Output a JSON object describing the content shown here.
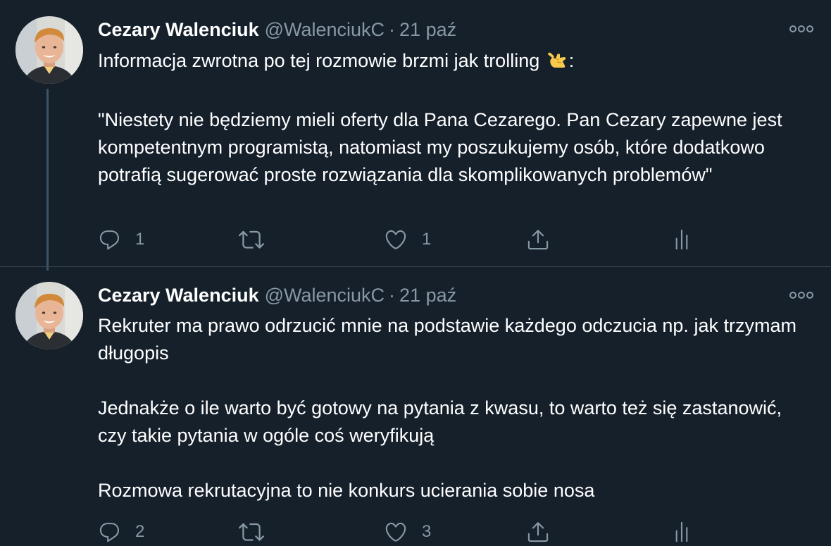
{
  "colors": {
    "background": "#15202b",
    "text": "#ffffff",
    "secondary": "#8899a6",
    "thread_line": "#3d5466",
    "divider": "#38444d"
  },
  "tweets": [
    {
      "author_name": "Cezary Walenciuk",
      "author_handle": "@WalenciukC",
      "separator": "·",
      "date": "21 paź",
      "paragraphs": [
        "Informacja zwrotna po tej rozmowie brzmi jak trolling",
        "\"Niestety nie będziemy mieli oferty dla Pana Cezarego. Pan Cezary zapewne jest kompetentnym programistą, natomiast my poszukujemy osób, które dodatkowo potrafią sugerować proste rozwiązania dla skomplikowanych problemów\""
      ],
      "emoji": "call-me-hand-emoji",
      "after_emoji": ":",
      "reply_count": "1",
      "like_count": "1"
    },
    {
      "author_name": "Cezary Walenciuk",
      "author_handle": "@WalenciukC",
      "separator": "·",
      "date": "21 paź",
      "paragraphs": [
        "Rekruter ma prawo odrzucić mnie na podstawie każdego odczucia np. jak trzymam długopis",
        "Jednakże o ile warto być gotowy na pytania z kwasu, to warto też się zastanowić, czy takie pytania w ogóle coś weryfikują",
        "Rozmowa rekrutacyjna to nie konkurs ucierania sobie nosa"
      ],
      "reply_count": "2",
      "like_count": "3"
    }
  ],
  "icons": {
    "reply": "reply-icon",
    "retweet": "retweet-icon",
    "like": "heart-icon",
    "share": "share-icon",
    "analytics": "analytics-icon",
    "more": "more-options-icon"
  }
}
